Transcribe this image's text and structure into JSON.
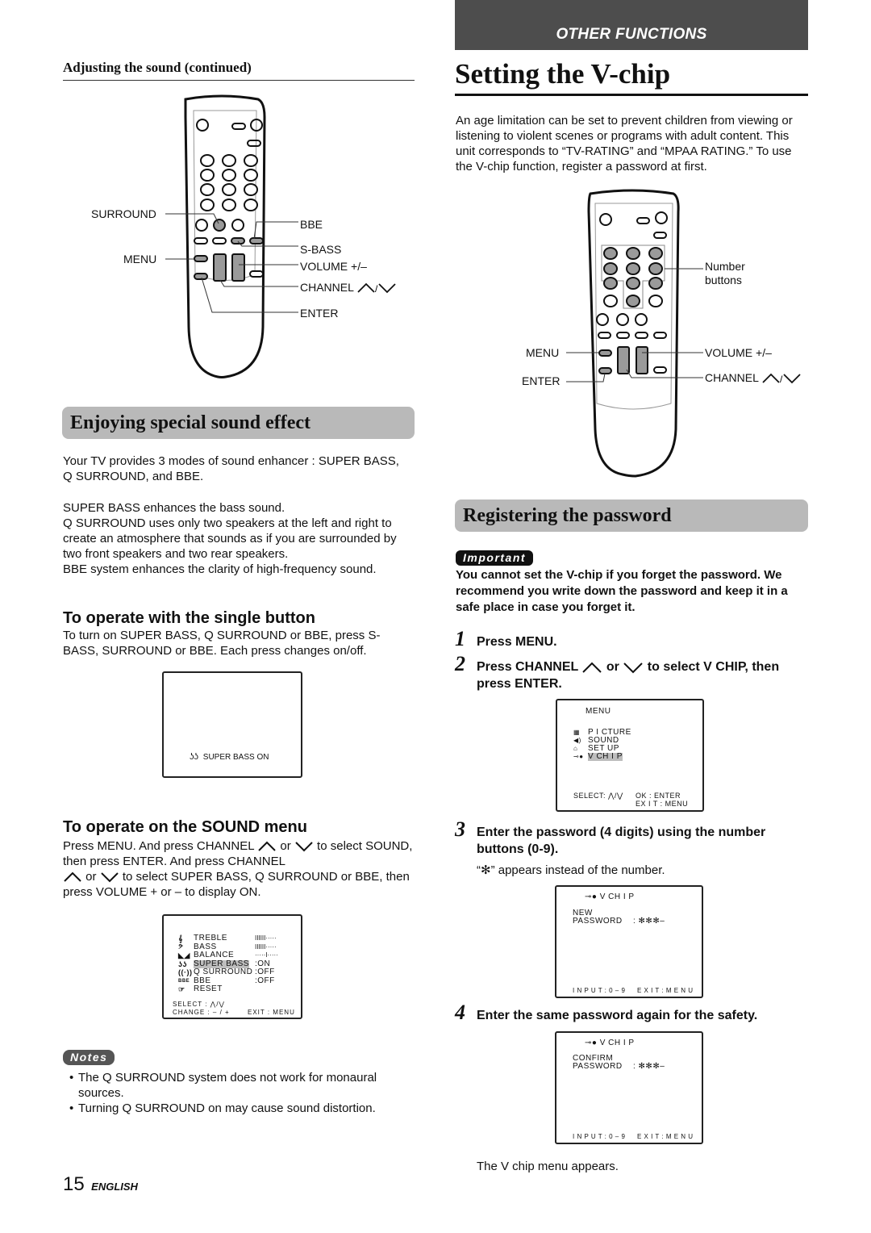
{
  "header": {
    "banner": "OTHER FUNCTIONS",
    "left_subhead": "Adjusting the sound (continued)",
    "right_title": "Setting the V-chip"
  },
  "remote_left": {
    "labels": {
      "surround": "SURROUND",
      "menu": "MENU",
      "bbe": "BBE",
      "sbass": "S-BASS",
      "volume": "VOLUME +/–",
      "channel": "CHANNEL",
      "enter": "ENTER"
    }
  },
  "intro_right": "An age limitation can be set to prevent children from viewing or listening to violent scenes or programs with adult content. This unit corresponds to “TV-RATING” and “MPAA RATING.” To use the V-chip function, register a password at first.",
  "remote_right": {
    "labels": {
      "number_buttons": "Number buttons",
      "menu": "MENU",
      "enter": "ENTER",
      "volume": "VOLUME +/–",
      "channel": "CHANNEL"
    }
  },
  "sound_effect": {
    "heading": "Enjoying special sound effect",
    "para1": "Your TV provides 3 modes of sound enhancer : SUPER BASS, Q SURROUND, and BBE.",
    "para2_lines": [
      "SUPER BASS enhances the bass sound.",
      "Q SURROUND uses only two speakers at the left and right to create an atmosphere that sounds as if you are surrounded by two front speakers and two rear speakers.",
      "BBE system enhances the clarity of high-frequency sound."
    ],
    "single_button": {
      "heading": "To operate with the single button",
      "text": "To turn on SUPER BASS, Q SURROUND or BBE, press S-BASS, SURROUND or BBE.  Each press changes on/off."
    },
    "osd_superbass": "SUPER BASS  ON",
    "sound_menu": {
      "heading": "To operate on the SOUND menu",
      "t1": "Press MENU.  And press CHANNEL",
      "t2": "or",
      "t3": "to select SOUND, then press ENTER.  And press CHANNEL",
      "t4": "or",
      "t5": "to select SUPER BASS, Q SURROUND or BBE, then press VOLUME + or – to display ON."
    },
    "sound_osd": {
      "items": [
        {
          "icon": "treble-clef-icon",
          "label": "TREBLE",
          "value": "IIIIII·····",
          "level": 0.55,
          "highlight": false
        },
        {
          "icon": "bass-clef-icon",
          "label": "BASS",
          "value": "IIIIII·····",
          "level": 0.55,
          "highlight": false
        },
        {
          "icon": "balance-icon",
          "label": "BALANCE",
          "value": "·····I·····",
          "level": 0.5,
          "highlight": false
        },
        {
          "icon": "super-bass-icon",
          "label": "SUPER BASS",
          "value": ":ON",
          "highlight": true
        },
        {
          "icon": "q-surround-icon",
          "label": "Q SURROUND",
          "value": ":OFF",
          "highlight": false
        },
        {
          "icon": "bbe-icon",
          "label": "BBE",
          "value": ":OFF",
          "highlight": false
        },
        {
          "icon": "reset-icon",
          "label": "RESET",
          "value": "",
          "highlight": false
        }
      ],
      "select": "SELECT : ⋀/⋁",
      "change": "CHANGE : – / +",
      "exit": "EXIT : MENU"
    },
    "notes": {
      "tag": "Notes",
      "items": [
        "The Q SURROUND system does not work for monaural sources.",
        "Turning Q SURROUND on may cause sound distortion."
      ]
    }
  },
  "password": {
    "heading": "Registering the password",
    "important_tag": "Important",
    "important_text": "You cannot set the V-chip if you forget the password. We recommend you write down the password and keep it in a safe place in case you forget it.",
    "steps": [
      {
        "num": "1",
        "text": "Press MENU."
      },
      {
        "num": "2",
        "text_a": "Press CHANNEL",
        "text_b": "or",
        "text_c": "to select V CHIP, then press ENTER."
      },
      {
        "num": "3",
        "text": "Enter the password (4 digits) using the number buttons (0-9).",
        "sub": "“✻” appears instead of the number."
      },
      {
        "num": "4",
        "text": "Enter the same password again for the safety.",
        "sub": "The V chip menu appears."
      }
    ],
    "menu_osd": {
      "title": "MENU",
      "items": [
        {
          "icon": "picture-icon",
          "label": "P I CTURE",
          "highlight": false
        },
        {
          "icon": "sound-icon",
          "label": "SOUND",
          "highlight": false
        },
        {
          "icon": "setup-icon",
          "label": "SET  UP",
          "highlight": false
        },
        {
          "icon": "key-icon",
          "label": "V  CH I P",
          "highlight": true
        }
      ],
      "select": "SELECT: ⋀/⋁",
      "ok": "OK : ENTER",
      "exit": "EX I T : MENU"
    },
    "new_pw_osd": {
      "title": "V  CH I P",
      "line1": "NEW",
      "line2": "PASSWORD",
      "value": ": ✻✻✻–",
      "input": "I N P U T : 0 – 9",
      "exit": "E X I T  :  M E N U"
    },
    "confirm_pw_osd": {
      "title": "V  CH I P",
      "line1": "CONFIRM",
      "line2": "PASSWORD",
      "value": ": ✻✻✻–",
      "input": "I N P U T : 0 – 9",
      "exit": "E X I T  :  M E N U"
    }
  },
  "footer": {
    "page_number": "15",
    "language": "ENGLISH"
  }
}
